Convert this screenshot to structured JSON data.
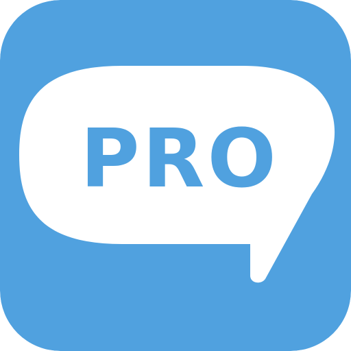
{
  "icon": {
    "name": "chat-pro-app-icon",
    "label": "PRO",
    "colors": {
      "background": "#50a1df",
      "bubble": "#ffffff",
      "text": "#50a1df"
    }
  }
}
